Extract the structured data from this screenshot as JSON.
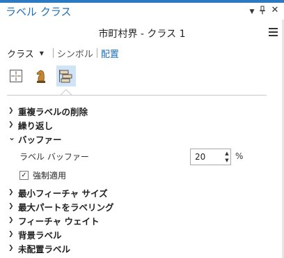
{
  "window": {
    "title": "ラベル クラス",
    "menu_glyph": "▼",
    "pin_glyph": "╤",
    "close_glyph": "✕"
  },
  "layer_name": "市町村界 - クラス 1",
  "tabs": {
    "class_label": "クラス",
    "class_arrow": "▼",
    "symbol_label": "シンボル",
    "placement_label": "配置"
  },
  "icon_row": [
    {
      "name": "position-icon",
      "selected": false
    },
    {
      "name": "chess-knight-icon",
      "selected": false
    },
    {
      "name": "label-placement-icon",
      "selected": true
    }
  ],
  "sections": [
    {
      "label": "重複ラベルの削除",
      "expanded": false
    },
    {
      "label": "繰り返し",
      "expanded": false
    },
    {
      "label": "バッファー",
      "expanded": true
    },
    {
      "label": "最小フィーチャ サイズ",
      "expanded": false
    },
    {
      "label": "最大パートをラベリング",
      "expanded": false
    },
    {
      "label": "フィーチャ ウェイト",
      "expanded": false
    },
    {
      "label": "背景ラベル",
      "expanded": false
    },
    {
      "label": "未配置ラベル",
      "expanded": false
    }
  ],
  "chevrons": {
    "collapsed": "❯",
    "expanded": "⌄"
  },
  "buffer": {
    "label": "ラベル バッファー",
    "value": "20",
    "unit": "%",
    "up_glyph": "▲",
    "down_glyph": "▼",
    "enforce_label": "強制適用",
    "enforce_checked": true,
    "check_glyph": "✓"
  },
  "colors": {
    "accent": "#1b6fb8",
    "top_bar": "#2b79c2",
    "selected_bg": "#cfe4f6"
  }
}
